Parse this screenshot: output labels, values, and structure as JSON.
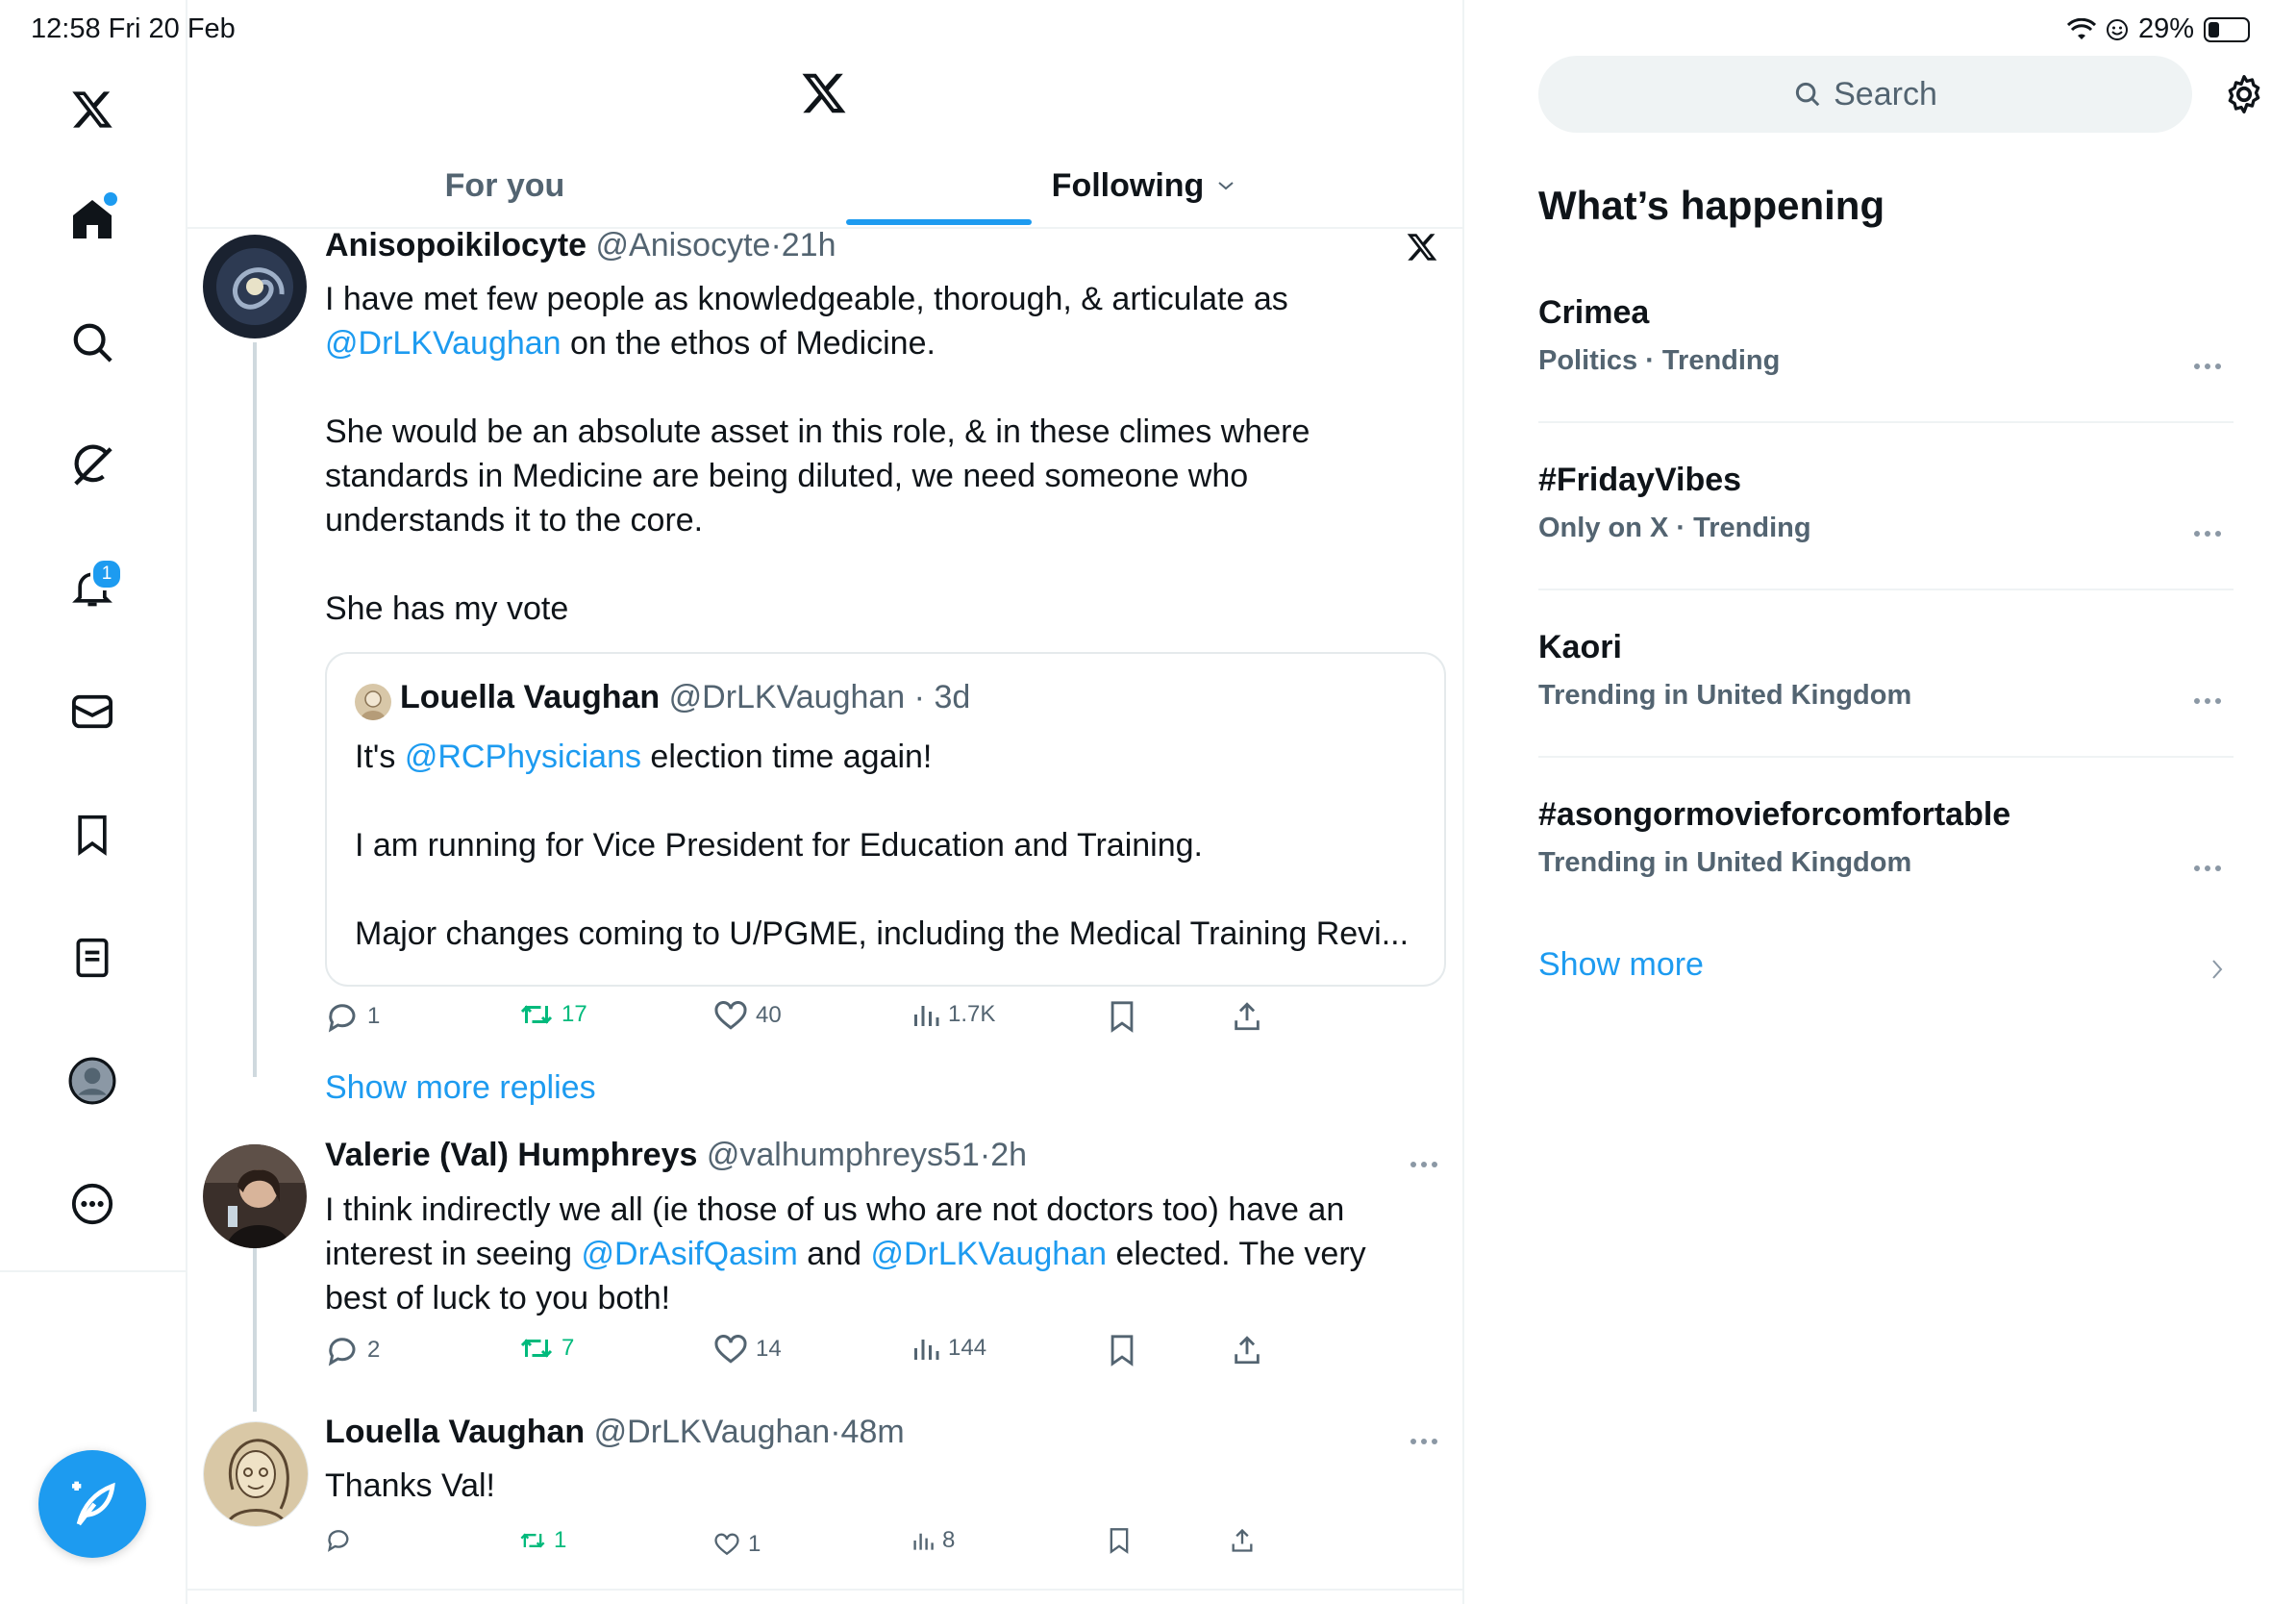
{
  "status": {
    "time_date": "12:58  Fri 20 Feb",
    "battery": "29%",
    "battery_level": 0.29
  },
  "nav": {
    "items": [
      {
        "name": "x-logo"
      },
      {
        "name": "home",
        "has_dot": true
      },
      {
        "name": "search"
      },
      {
        "name": "grok"
      },
      {
        "name": "notifications",
        "badge": "1"
      },
      {
        "name": "messages"
      },
      {
        "name": "bookmarks"
      },
      {
        "name": "lists"
      },
      {
        "name": "profile"
      },
      {
        "name": "more"
      }
    ]
  },
  "main": {
    "tabs": [
      {
        "label": "For you",
        "active": false
      },
      {
        "label": "Following",
        "active": true
      }
    ],
    "tweets": [
      {
        "name": "Anisopoikilocyte",
        "handle": "@Anisocyte",
        "time": "21h",
        "body": [
          [
            {
              "t": "I have met few people as knowledgeable, thorough, & articulate as"
            }
          ],
          [
            {
              "t": "@DrLKVaughan",
              "link": true
            },
            {
              "t": " on the ethos of Medicine."
            }
          ],
          [],
          [
            {
              "t": "She would be an absolute asset in this role, & in these climes where"
            }
          ],
          [
            {
              "t": "standards in Medicine are being diluted, we need someone who"
            }
          ],
          [
            {
              "t": "understands it to the core."
            }
          ],
          [],
          [
            {
              "t": "She has my vote"
            }
          ]
        ],
        "quote": {
          "name": "Louella Vaughan",
          "handle": "@DrLKVaughan",
          "time": "3d",
          "body": [
            [
              {
                "t": "It's "
              },
              {
                "t": "@RCPhysicians",
                "link": true
              },
              {
                "t": " election time again!"
              }
            ],
            [],
            [
              {
                "t": "I am running for Vice President for Education and Training."
              }
            ],
            [],
            [
              {
                "t": "Major changes coming to U/PGME, including the Medical Training Revi..."
              }
            ]
          ]
        },
        "replies": "1",
        "reposts": "17",
        "likes": "40",
        "views": "1.7K"
      },
      {
        "name": "Valerie (Val) Humphreys",
        "handle": "@valhumphreys51",
        "time": "2h",
        "body": [
          [
            {
              "t": "I think indirectly we all (ie those of us who are not doctors too) have an"
            }
          ],
          [
            {
              "t": "interest in seeing "
            },
            {
              "t": "@DrAsifQasim",
              "link": true
            },
            {
              "t": " and "
            },
            {
              "t": "@DrLKVaughan",
              "link": true
            },
            {
              "t": " elected. The very"
            }
          ],
          [
            {
              "t": "best of luck to you both!"
            }
          ]
        ],
        "replies": "2",
        "reposts": "7",
        "likes": "14",
        "views": "144"
      },
      {
        "name": "Louella Vaughan",
        "handle": "@DrLKVaughan",
        "time": "48m",
        "body": [
          [
            {
              "t": "Thanks Val!"
            }
          ]
        ],
        "replies": "",
        "reposts": "1",
        "likes": "1",
        "views": "8"
      }
    ],
    "show_more_replies": "Show more replies"
  },
  "right": {
    "search_label": "Search",
    "heading": "What’s happening",
    "trends": [
      {
        "title": "Crimea",
        "sub": "Politics · Trending"
      },
      {
        "title": "#FridayVibes",
        "sub": "Only on X · Trending"
      },
      {
        "title": "Kaori",
        "sub": "Trending in United Kingdom"
      },
      {
        "title": "#asongormovieforcomfortable",
        "sub": "Trending in United Kingdom"
      }
    ],
    "show_more": "Show more"
  },
  "colors": {
    "accent": "#1d9bf0",
    "repost": "#00ba7c",
    "muted": "#536471"
  }
}
